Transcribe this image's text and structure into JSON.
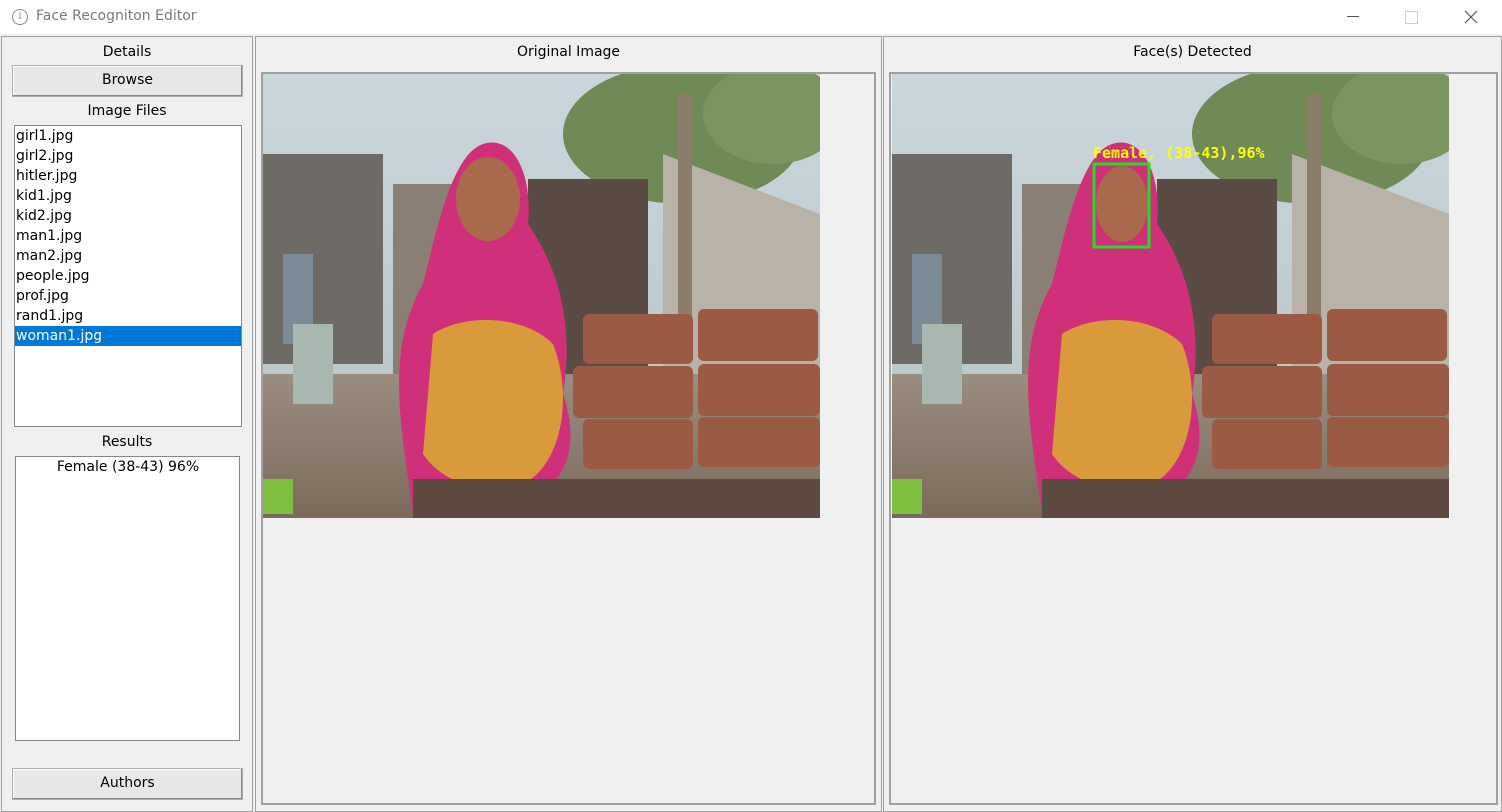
{
  "window": {
    "title": "Face Recogniton Editor",
    "icon": "info-icon"
  },
  "left": {
    "details_label": "Details",
    "browse_label": "Browse",
    "image_files_label": "Image Files",
    "files": [
      "girl1.jpg",
      "girl2.jpg",
      "hitler.jpg",
      "kid1.jpg",
      "kid2.jpg",
      "man1.jpg",
      "man2.jpg",
      "people.jpg",
      "prof.jpg",
      "rand1.jpg",
      "woman1.jpg"
    ],
    "selected_file": "woman1.jpg",
    "results_label": "Results",
    "results": [
      "Female (38-43) 96%"
    ],
    "authors_label": "Authors"
  },
  "original": {
    "header": "Original Image"
  },
  "detected": {
    "header": "Face(s) Detected",
    "face_label": "Female, (38-43),96%",
    "box_color": "#22dd22",
    "label_color": "#ffff00"
  },
  "colors": {
    "selection": "#0078d7",
    "background": "#f0f0f0"
  }
}
